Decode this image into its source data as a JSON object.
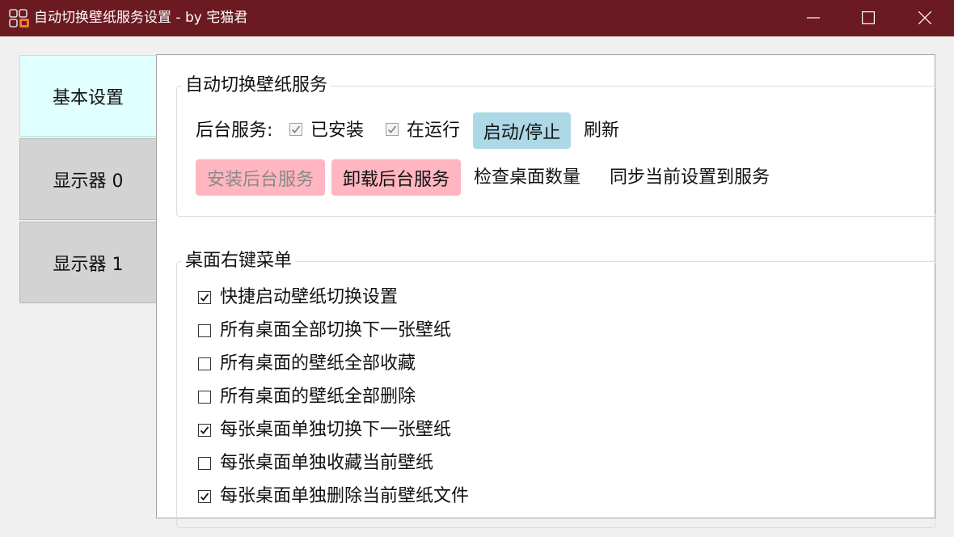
{
  "window": {
    "title": "自动切换壁纸服务设置 - by 宅猫君",
    "icon": "app-grid-icon",
    "controls": [
      "minimize-icon",
      "maximize-icon",
      "close-icon"
    ]
  },
  "tabs": [
    {
      "label": "基本设置",
      "active": true
    },
    {
      "label": "显示器 0",
      "active": false
    },
    {
      "label": "显示器 1",
      "active": false
    }
  ],
  "service_group": {
    "title": "自动切换壁纸服务",
    "status_label": "后台服务:",
    "installed": {
      "label": "已安装",
      "checked": true,
      "enabled": false
    },
    "running": {
      "label": "在运行",
      "checked": true,
      "enabled": false
    },
    "start_stop_label": "启动/停止",
    "refresh_label": "刷新",
    "install_label": "安装后台服务",
    "uninstall_label": "卸载后台服务",
    "check_desktops_label": "检查桌面数量",
    "sync_label": "同步当前设置到服务"
  },
  "context_menu_group": {
    "title": "桌面右键菜单",
    "items": [
      {
        "label": "快捷启动壁纸切换设置",
        "checked": true
      },
      {
        "label": "所有桌面全部切换下一张壁纸",
        "checked": false
      },
      {
        "label": "所有桌面的壁纸全部收藏",
        "checked": false
      },
      {
        "label": "所有桌面的壁纸全部删除",
        "checked": false
      },
      {
        "label": "每张桌面单独切换下一张壁纸",
        "checked": true
      },
      {
        "label": "每张桌面单独收藏当前壁纸",
        "checked": false
      },
      {
        "label": "每张桌面单独删除当前壁纸文件",
        "checked": true
      }
    ]
  },
  "colors": {
    "titlebar": "#6b1a21",
    "active_tab": "#e0ffff",
    "inactive_tab": "#d3d3d3",
    "start_button": "#add8e6",
    "service_buttons": "#ffb6c1"
  }
}
